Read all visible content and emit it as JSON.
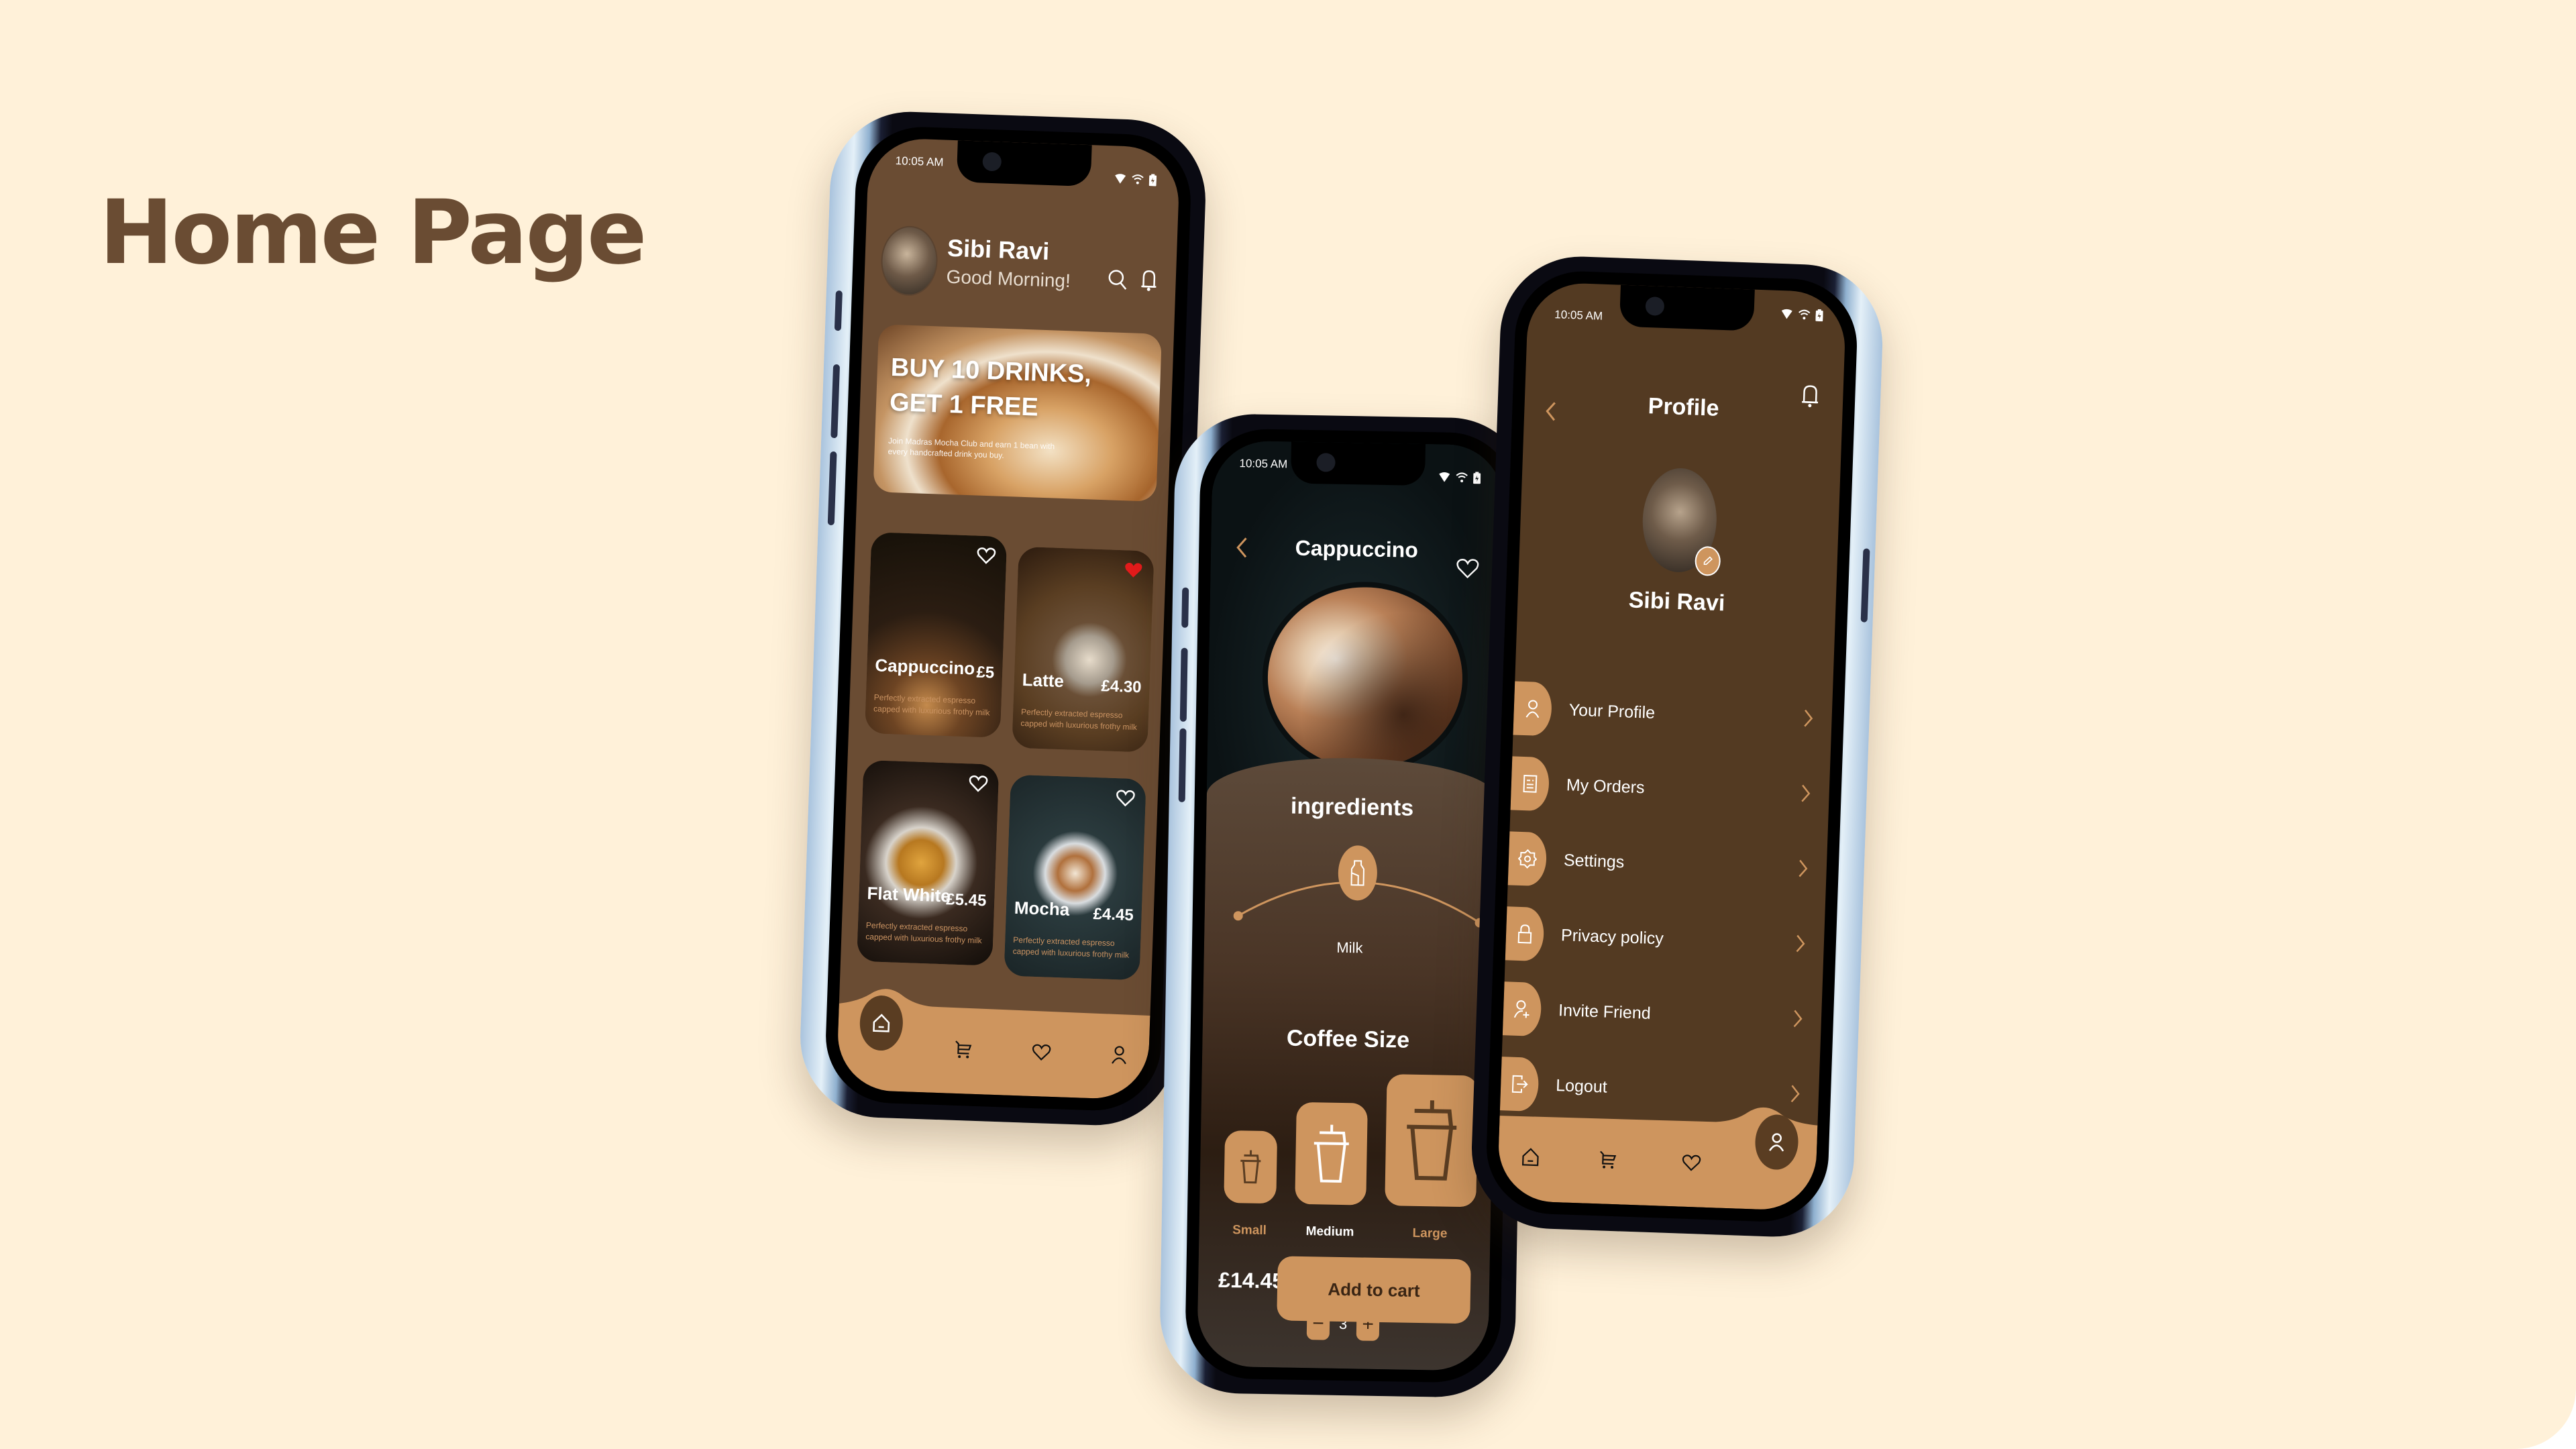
{
  "page": {
    "title": "Home Page"
  },
  "colors": {
    "background": "#FFF1D9",
    "title": "#6A4C33",
    "accent": "#CE955E",
    "home_bg": "#6A4C33",
    "profile_bg": "#533A22",
    "favorite": "#E21B1B"
  },
  "status_bar": {
    "time": "10:05 AM",
    "icons": [
      "signal-icon",
      "wifi-icon",
      "battery-charging-icon"
    ]
  },
  "home": {
    "user_name": "Sibi Ravi",
    "greeting": "Good Morning!",
    "header_icons": [
      "search-icon",
      "bell-icon"
    ],
    "promo": {
      "title_line1": "BUY 10 DRINKS,",
      "title_line2": "GET 1 FREE",
      "subtitle": "Join Madras Mocha Club and earn 1 bean with every handcrafted drink you buy."
    },
    "products": [
      {
        "name": "Cappuccino",
        "price": "£5",
        "description": "Perfectly extracted espresso capped with luxurious frothy milk",
        "favorite": false
      },
      {
        "name": "Latte",
        "price": "£4.30",
        "description": "Perfectly extracted espresso capped with luxurious frothy milk",
        "favorite": true
      },
      {
        "name": "Flat White",
        "price": "£5.45",
        "description": "Perfectly extracted espresso capped with luxurious frothy milk",
        "favorite": false
      },
      {
        "name": "Mocha",
        "price": "£4.45",
        "description": "Perfectly extracted espresso capped with luxurious frothy milk",
        "favorite": false
      }
    ],
    "nav": {
      "active": "home",
      "items": [
        "home-icon",
        "cart-icon",
        "heart-icon",
        "user-icon"
      ]
    }
  },
  "detail": {
    "title": "Cappuccino",
    "ingredients_title": "ingredients",
    "ingredient": "Milk",
    "size_title": "Coffee Size",
    "sizes": [
      {
        "label": "Small",
        "selected": false
      },
      {
        "label": "Medium",
        "selected": true
      },
      {
        "label": "Large",
        "selected": false
      }
    ],
    "quantity": "3",
    "minus_label": "−",
    "plus_label": "+",
    "total": "£14.45",
    "add_to_cart": "Add to cart"
  },
  "profile": {
    "title": "Profile",
    "user_name": "Sibi Ravi",
    "menu": [
      {
        "label": "Your Profile",
        "icon": "user-icon"
      },
      {
        "label": "My Orders",
        "icon": "orders-icon"
      },
      {
        "label": "Settings",
        "icon": "gear-icon"
      },
      {
        "label": "Privacy policy",
        "icon": "lock-icon"
      },
      {
        "label": "Invite Friend",
        "icon": "add-user-icon"
      },
      {
        "label": "Logout",
        "icon": "logout-icon"
      }
    ],
    "nav": {
      "active": "profile",
      "items": [
        "home-icon",
        "cart-icon",
        "heart-icon",
        "user-icon"
      ]
    }
  }
}
